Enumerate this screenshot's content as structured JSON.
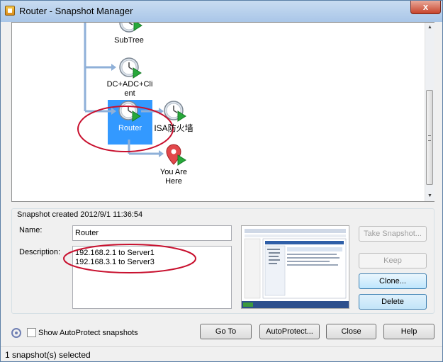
{
  "window": {
    "title": "Router - Snapshot Manager",
    "close_glyph": "x"
  },
  "tree": {
    "nodes": [
      {
        "id": "subtree",
        "label": "SubTree",
        "icon": "snapshot-clock-icon"
      },
      {
        "id": "dc-adc-client",
        "label": "DC+ADC+Client",
        "label_lines": [
          "DC+ADC+Cli",
          "ent"
        ],
        "icon": "snapshot-clock-icon"
      },
      {
        "id": "router",
        "label": "Router",
        "icon": "snapshot-clock-icon",
        "selected": true
      },
      {
        "id": "isa",
        "label": "ISA防火墙",
        "icon": "snapshot-clock-icon"
      },
      {
        "id": "you-are-here",
        "label": "You Are Here",
        "label_lines": [
          "You Are",
          "Here"
        ],
        "icon": "you-are-here-pin-icon"
      }
    ]
  },
  "details": {
    "created": "Snapshot created 2012/9/1 11:36:54",
    "name_label": "Name:",
    "name_value": "Router",
    "description_label": "Description:",
    "description_lines": [
      "192.168.2.1 to Server1",
      "192.168.3.1 to Server3"
    ]
  },
  "actions": {
    "take_snapshot": "Take Snapshot...",
    "keep": "Keep",
    "clone": "Clone...",
    "delete": "Delete"
  },
  "footer": {
    "show_autoprotect": "Show AutoProtect snapshots",
    "show_autoprotect_checked": false,
    "goto": "Go To",
    "autoprotect": "AutoProtect...",
    "close": "Close",
    "help": "Help"
  },
  "status": {
    "text": "1 snapshot(s) selected"
  },
  "colors": {
    "selection": "#3399ff",
    "annotation": "#c8102e",
    "connector": "#8fb0d8",
    "play": "#27a83a"
  }
}
